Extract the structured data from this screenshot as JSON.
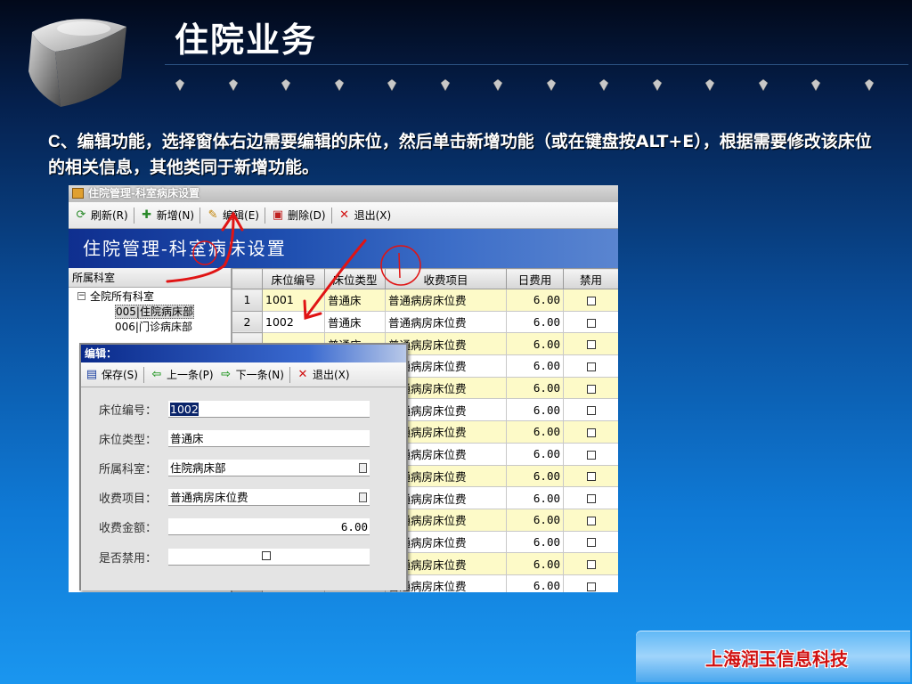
{
  "slide": {
    "title": "住院业务",
    "intro_lead": "C",
    "intro_text": "、编辑功能，选择窗体右边需要编辑的床位，然后单击新增功能（或在键盘按ALT+E），根据需要修改该床位的相关信息，其他类同于新增功能。",
    "footer": "上海润玉信息科技"
  },
  "window": {
    "title": "住院管理-科室病床设置",
    "toolbar": {
      "refresh": "刷新(R)",
      "add": "新增(N)",
      "edit": "编辑(E)",
      "delete": "删除(D)",
      "exit": "退出(X)"
    },
    "banner": "住院管理-科室病床设置"
  },
  "tree": {
    "header": "所属科室",
    "root": "全院所有科室",
    "items": [
      "005|住院病床部",
      "006|门诊病床部"
    ]
  },
  "grid": {
    "headers": [
      "",
      "床位编号",
      "床位类型",
      "收费项目",
      "日费用",
      "禁用"
    ],
    "rows": [
      {
        "rn": "1",
        "bed": "1001",
        "type": "普通床",
        "fee": "普通病房床位费",
        "cost": "6.00"
      },
      {
        "rn": "2",
        "bed": "1002",
        "type": "普通床",
        "fee": "普通病房床位费",
        "cost": "6.00"
      },
      {
        "rn": "",
        "bed": "",
        "type": "普通床",
        "fee": "普通病房床位费",
        "cost": "6.00"
      },
      {
        "rn": "",
        "bed": "",
        "type": "",
        "fee": "普通病房床位费",
        "cost": "6.00"
      },
      {
        "rn": "",
        "bed": "",
        "type": "",
        "fee": "普通病房床位费",
        "cost": "6.00"
      },
      {
        "rn": "",
        "bed": "",
        "type": "",
        "fee": "普通病房床位费",
        "cost": "6.00"
      },
      {
        "rn": "",
        "bed": "",
        "type": "",
        "fee": "普通病房床位费",
        "cost": "6.00"
      },
      {
        "rn": "",
        "bed": "",
        "type": "",
        "fee": "普通病房床位费",
        "cost": "6.00"
      },
      {
        "rn": "",
        "bed": "",
        "type": "",
        "fee": "普通病房床位费",
        "cost": "6.00"
      },
      {
        "rn": "",
        "bed": "",
        "type": "",
        "fee": "普通病房床位费",
        "cost": "6.00"
      },
      {
        "rn": "",
        "bed": "",
        "type": "",
        "fee": "普通病房床位费",
        "cost": "6.00"
      },
      {
        "rn": "",
        "bed": "",
        "type": "",
        "fee": "普通病房床位费",
        "cost": "6.00"
      },
      {
        "rn": "",
        "bed": "",
        "type": "",
        "fee": "普通病房床位费",
        "cost": "6.00"
      },
      {
        "rn": "",
        "bed": "",
        "type": "",
        "fee": "普通病房床位费",
        "cost": "6.00"
      }
    ]
  },
  "edit_dialog": {
    "title": "编辑：",
    "toolbar": {
      "save": "保存(S)",
      "prev": "上一条(P)",
      "next": "下一条(N)",
      "exit": "退出(X)"
    },
    "fields": {
      "bed_no_label": "床位编号：",
      "bed_no_value": "1002",
      "bed_type_label": "床位类型：",
      "bed_type_value": "普通床",
      "dept_label": "所属科室：",
      "dept_value": "住院病床部",
      "fee_item_label": "收费项目：",
      "fee_item_value": "普通病房床位费",
      "fee_amount_label": "收费金额：",
      "fee_amount_value": "6.00",
      "disabled_label": "是否禁用："
    }
  }
}
